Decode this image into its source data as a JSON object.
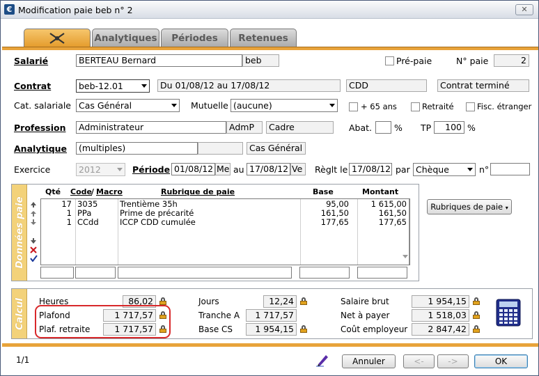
{
  "window": {
    "title": "Modification paie beb n° 2",
    "app_icon": "€",
    "close": "✕"
  },
  "tabs": [
    "Analytiques",
    "Périodes",
    "Retenues"
  ],
  "salarie": {
    "label": "Salarié",
    "name": "BERTEAU Bernard",
    "code": "beb",
    "pre_paie_label": "Pré-paie",
    "num_paie_label": "N° paie",
    "num_paie": "2"
  },
  "contrat": {
    "label": "Contrat",
    "value": "beb-12.01",
    "periode": "Du 01/08/12 au 17/08/12",
    "type": "CDD",
    "statut": "Contrat terminé"
  },
  "cat": {
    "label": "Cat. salariale",
    "value": "Cas Général",
    "mutuelle_label": "Mutuelle",
    "mutuelle": "(aucune)",
    "plus65": "+ 65 ans",
    "retraite": "Retraité",
    "fisc": "Fisc. étranger"
  },
  "profession": {
    "label": "Profession",
    "value": "Administrateur",
    "code": "AdmP",
    "categorie": "Cadre",
    "abat_label": "Abat.",
    "abat": "",
    "pct": "%",
    "tp_label": "TP",
    "tp": "100",
    "tp_pct": "%"
  },
  "analytique": {
    "label": "Analytique",
    "value": "(multiples)",
    "blank": "",
    "cat": "Cas Général"
  },
  "exercice": {
    "label": "Exercice",
    "value": "2012",
    "periode_label": "Période",
    "debut": "01/08/12",
    "debut_j": "Me",
    "au": "au",
    "fin": "17/08/12",
    "fin_j": "Ve",
    "reglt_label": "Règlt le",
    "reglt": "17/08/12",
    "par": "par",
    "mode": "Chèque",
    "no": "n°",
    "no_val": ""
  },
  "donnees": {
    "side": "Données paie",
    "headers": {
      "qte": "Qté",
      "code": "Code",
      "slash": "/",
      "macro": "Macro",
      "rubrique": "Rubrique de paie",
      "base": "Base",
      "montant": "Montant"
    },
    "rows": [
      {
        "qte": "17",
        "code": "3035",
        "rubrique": "Trentième 35h",
        "base": "95,00",
        "montant": "1 615,00"
      },
      {
        "qte": "1",
        "code": "PPa",
        "rubrique": "Prime de précarité",
        "base": "161,50",
        "montant": "161,50"
      },
      {
        "qte": "1",
        "code": "CCdd",
        "rubrique": "ICCP CDD cumulée",
        "base": "177,65",
        "montant": "177,65"
      }
    ],
    "rubriques_btn": "Rubriques de paie"
  },
  "calcul": {
    "side": "Calcul",
    "heures_label": "Heures",
    "heures": "86,02",
    "plafond_label": "Plafond",
    "plafond": "1 717,57",
    "plaf_retraite_label": "Plaf. retraite",
    "plaf_retraite": "1 717,57",
    "jours_label": "Jours",
    "jours": "12,24",
    "tranche_a_label": "Tranche A",
    "tranche_a": "1 717,57",
    "base_cs_label": "Base CS",
    "base_cs": "1 954,15",
    "brut_label": "Salaire brut",
    "brut": "1 954,15",
    "net_label": "Net à payer",
    "net": "1 518,03",
    "cout_label": "Coût employeur",
    "cout": "2 847,42"
  },
  "footer": {
    "page": "1/1",
    "annuler": "Annuler",
    "prev": "<-",
    "next": "->",
    "ok": "OK"
  },
  "colors": {
    "accent": "#e8a33a",
    "side_panel": "#f3d27a",
    "highlight": "#d8282a"
  }
}
